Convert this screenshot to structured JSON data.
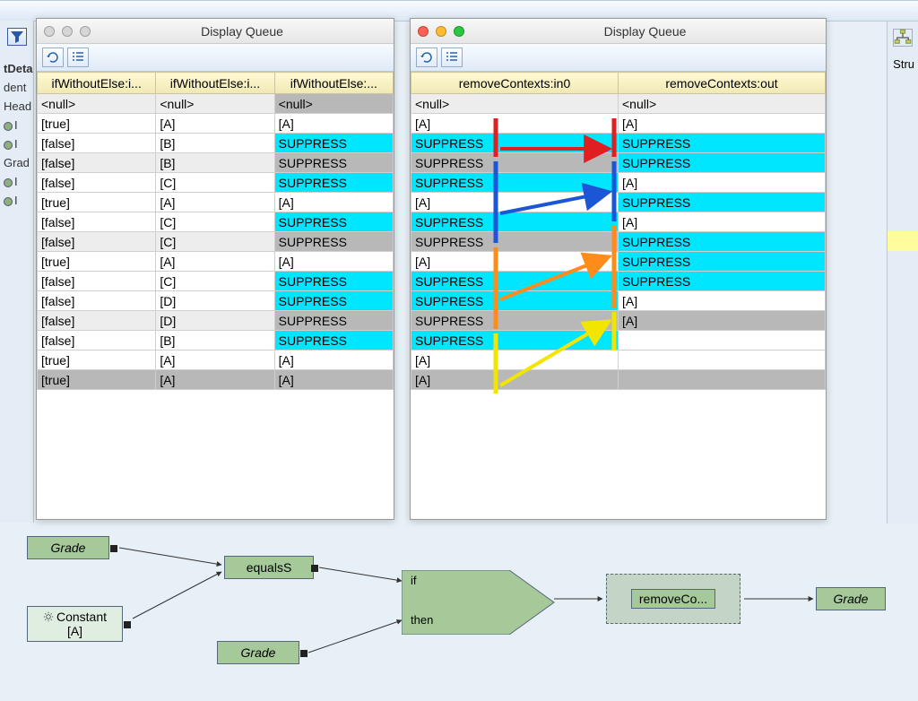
{
  "window_left": {
    "title": "Display Queue",
    "columns": [
      "ifWithoutElse:i...",
      "ifWithoutElse:i...",
      "ifWithoutElse:..."
    ],
    "rows": [
      {
        "cells": [
          "<null>",
          "<null>",
          "<null>"
        ],
        "alt": true,
        "gray": [
          2
        ]
      },
      {
        "cells": [
          "[true]",
          "[A]",
          "[A]"
        ]
      },
      {
        "cells": [
          "[false]",
          "[B]",
          "SUPPRESS"
        ],
        "supp": [
          2
        ]
      },
      {
        "cells": [
          "[false]",
          "[B]",
          "SUPPRESS"
        ],
        "alt": true,
        "gray": [
          2
        ]
      },
      {
        "cells": [
          "[false]",
          "[C]",
          "SUPPRESS"
        ],
        "supp": [
          2
        ]
      },
      {
        "cells": [
          "[true]",
          "[A]",
          "[A]"
        ]
      },
      {
        "cells": [
          "[false]",
          "[C]",
          "SUPPRESS"
        ],
        "supp": [
          2
        ]
      },
      {
        "cells": [
          "[false]",
          "[C]",
          "SUPPRESS"
        ],
        "alt": true,
        "gray": [
          2
        ]
      },
      {
        "cells": [
          "[true]",
          "[A]",
          "[A]"
        ]
      },
      {
        "cells": [
          "[false]",
          "[C]",
          "SUPPRESS"
        ],
        "supp": [
          2
        ]
      },
      {
        "cells": [
          "[false]",
          "[D]",
          "SUPPRESS"
        ],
        "supp": [
          2
        ]
      },
      {
        "cells": [
          "[false]",
          "[D]",
          "SUPPRESS"
        ],
        "alt": true,
        "gray": [
          2
        ]
      },
      {
        "cells": [
          "[false]",
          "[B]",
          "SUPPRESS"
        ],
        "supp": [
          2
        ]
      },
      {
        "cells": [
          "[true]",
          "[A]",
          "[A]"
        ]
      },
      {
        "cells": [
          "[true]",
          "[A]",
          "[A]"
        ],
        "grayrow": true
      }
    ]
  },
  "window_right": {
    "title": "Display Queue",
    "columns": [
      "removeContexts:in0",
      "removeContexts:out"
    ],
    "rows": [
      {
        "cells": [
          "<null>",
          "<null>"
        ],
        "alt": true
      },
      {
        "cells": [
          "[A]",
          "[A]"
        ]
      },
      {
        "cells": [
          "SUPPRESS",
          "SUPPRESS"
        ],
        "supp": [
          0,
          1
        ]
      },
      {
        "cells": [
          "SUPPRESS",
          "SUPPRESS"
        ],
        "alt": true,
        "gray": [
          0
        ],
        "supp": [
          1
        ]
      },
      {
        "cells": [
          "SUPPRESS",
          "[A]"
        ],
        "supp": [
          0
        ]
      },
      {
        "cells": [
          "[A]",
          "SUPPRESS"
        ],
        "supp": [
          1
        ]
      },
      {
        "cells": [
          "SUPPRESS",
          "[A]"
        ],
        "supp": [
          0
        ]
      },
      {
        "cells": [
          "SUPPRESS",
          "SUPPRESS"
        ],
        "alt": true,
        "gray": [
          0
        ],
        "supp": [
          1
        ]
      },
      {
        "cells": [
          "[A]",
          "SUPPRESS"
        ],
        "supp": [
          1
        ]
      },
      {
        "cells": [
          "SUPPRESS",
          "SUPPRESS"
        ],
        "supp": [
          0,
          1
        ]
      },
      {
        "cells": [
          "SUPPRESS",
          "[A]"
        ],
        "supp": [
          0
        ]
      },
      {
        "cells": [
          "SUPPRESS",
          "[A]"
        ],
        "alt": true,
        "gray": [
          0,
          1
        ]
      },
      {
        "cells": [
          "SUPPRESS",
          ""
        ],
        "supp": [
          0
        ]
      },
      {
        "cells": [
          "[A]",
          ""
        ]
      },
      {
        "cells": [
          "[A]",
          ""
        ],
        "grayrow": true,
        "graycells": [
          0
        ]
      }
    ]
  },
  "left_partial": {
    "label_detail": "tDeta",
    "label_dent": "dent",
    "label_header": "Head",
    "row1": "I",
    "row2": "I",
    "label_grade": "Grad",
    "row3": "I",
    "row4": "I"
  },
  "right_partial": {
    "label_struct": "Stru",
    "tree_icon": "tree-icon"
  },
  "flow": {
    "node_grade1": "Grade",
    "node_constant": "Constant",
    "constant_value": "[A]",
    "node_equalsS": "equalsS",
    "node_grade2": "Grade",
    "if_label": "if",
    "then_label": "then",
    "node_removeCo": "removeCo...",
    "node_grade_out": "Grade"
  },
  "arrows": [
    {
      "color": "#e02020",
      "from": [
        2,
        0
      ],
      "to": [
        2,
        1
      ]
    },
    {
      "color": "#1a56d6",
      "from": [
        5,
        0
      ],
      "to": [
        4,
        1
      ]
    },
    {
      "color": "#ff8c1a",
      "from": [
        9,
        0
      ],
      "to": [
        7,
        1
      ]
    },
    {
      "color": "#f2e500",
      "from": [
        13,
        0
      ],
      "to": [
        10,
        1
      ]
    }
  ]
}
